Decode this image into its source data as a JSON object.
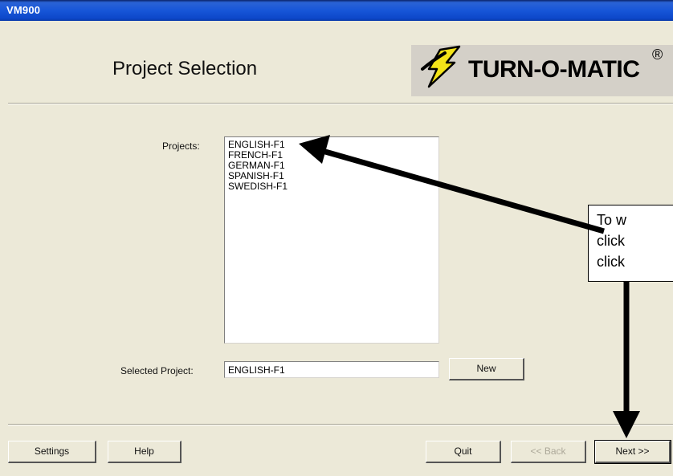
{
  "window": {
    "title": "VM900"
  },
  "page": {
    "heading": "Project Selection"
  },
  "logo": {
    "text": "TURN-O-MATIC",
    "reg_mark": "®"
  },
  "projects": {
    "label": "Projects:",
    "items": [
      "ENGLISH-F1",
      "FRENCH-F1",
      "GERMAN-F1",
      "SPANISH-F1",
      "SWEDISH-F1"
    ]
  },
  "selected_project": {
    "label": "Selected Project:",
    "value": "ENGLISH-F1"
  },
  "buttons": {
    "new": "New",
    "settings": "Settings",
    "help": "Help",
    "quit": "Quit",
    "back": "<< Back",
    "next": "Next >>"
  },
  "callout": {
    "lines": [
      "To w",
      "click",
      "click"
    ]
  },
  "colors": {
    "titlebar": "#0d47c9",
    "logo_bolt": "#f3e318",
    "background": "#ece9d8"
  }
}
